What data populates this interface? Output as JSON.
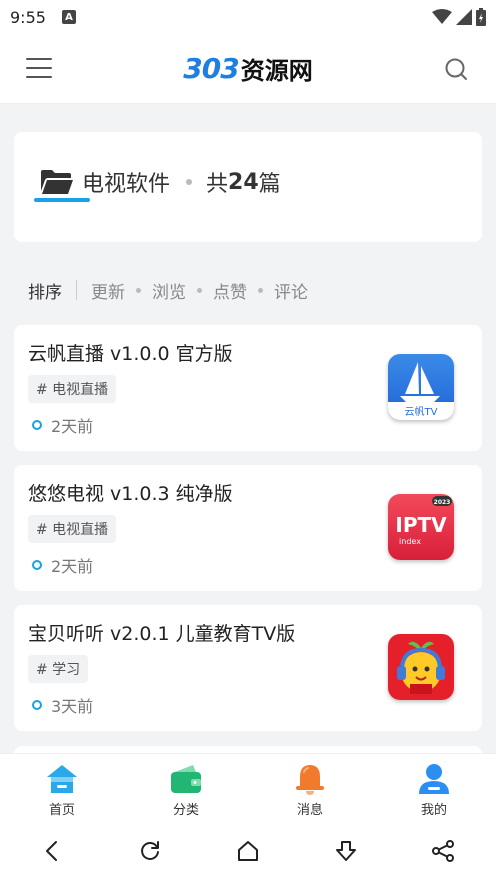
{
  "status_bar": {
    "time": "9:55",
    "notification_glyph": "A"
  },
  "header": {
    "menu_icon": "hamburger-icon",
    "logo_number": "303",
    "logo_text": "资源网",
    "search_icon": "search-icon",
    "logo_color": "#1f7fe0"
  },
  "category": {
    "icon": "folder-open-icon",
    "name": "电视软件",
    "count_prefix": "共",
    "count": "24",
    "count_suffix": "篇",
    "accent_color": "#18a0e8"
  },
  "sort": {
    "label": "排序",
    "options": [
      "更新",
      "浏览",
      "点赞",
      "评论"
    ]
  },
  "posts": [
    {
      "title": "云帆直播 v1.0.0 官方版",
      "tag": "# 电视直播",
      "time": "2天前",
      "thumb_icon": "yunfan-tv-app-icon",
      "thumb_caption": "云帆TV"
    },
    {
      "title": "悠悠电视 v1.0.3 纯净版",
      "tag": "# 电视直播",
      "time": "2天前",
      "thumb_icon": "iptv-app-icon",
      "thumb_caption": "IPTV",
      "thumb_subcaption": "index",
      "thumb_badge": "2023"
    },
    {
      "title": "宝贝听听 v2.0.1 儿童教育TV版",
      "tag": "# 学习",
      "time": "3天前",
      "thumb_icon": "baby-listen-app-icon"
    }
  ],
  "tabs": [
    {
      "label": "首页",
      "icon": "home-icon",
      "color": "#2aa8e8"
    },
    {
      "label": "分类",
      "icon": "wallet-icon",
      "color": "#22b573"
    },
    {
      "label": "消息",
      "icon": "bell-icon",
      "color": "#f27a2c"
    },
    {
      "label": "我的",
      "icon": "user-icon",
      "color": "#2a8ff0"
    }
  ],
  "system_nav": [
    "back-icon",
    "refresh-icon",
    "home-outline-icon",
    "download-icon",
    "share-icon"
  ]
}
